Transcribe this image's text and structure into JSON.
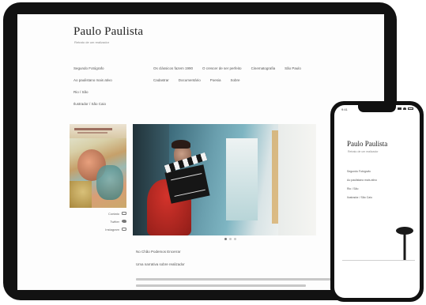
{
  "tablet": {
    "site_title": "Paulo Paulista",
    "site_subtitle": "Retrato de um realizador",
    "info_lines": [
      "Segundo Fotógrafo",
      "Ao paulistano mais ativo",
      "Rio / São",
      "Ilustrador / São Caio"
    ],
    "nav_rows": [
      [
        "Os clássicos fazem 1990",
        "O crescer de ser perfeito",
        "Cinematografia",
        "São Paulo"
      ],
      [
        "Cadastrar",
        "Documentário",
        "Poesia",
        "Sobre"
      ]
    ],
    "poster_links": [
      "Contato",
      "Twitter",
      "Instagram"
    ],
    "caption_1": "No Chão Podemos Encerrar",
    "caption_2": "Uma narrativa sobre realizador",
    "carousel": {
      "slides": 3,
      "active_index": 0
    }
  },
  "phone": {
    "status_time": "9:41",
    "site_title": "Paulo Paulista",
    "site_subtitle": "Retrato de um realizador",
    "info_lines": [
      "Segundo Fotógrafo",
      "Ao paulistano mais ativo",
      "Rio / São",
      "Ilustrador / São Caio"
    ]
  },
  "colors": {
    "device_frame": "#121212",
    "page_background": "#fdfdfd",
    "hero_accent_red": "#d3332b",
    "hero_accent_teal": "#6a9fae"
  },
  "icons": {
    "link_icons": [
      "envelope-icon",
      "bird-icon",
      "camera-icon"
    ]
  }
}
